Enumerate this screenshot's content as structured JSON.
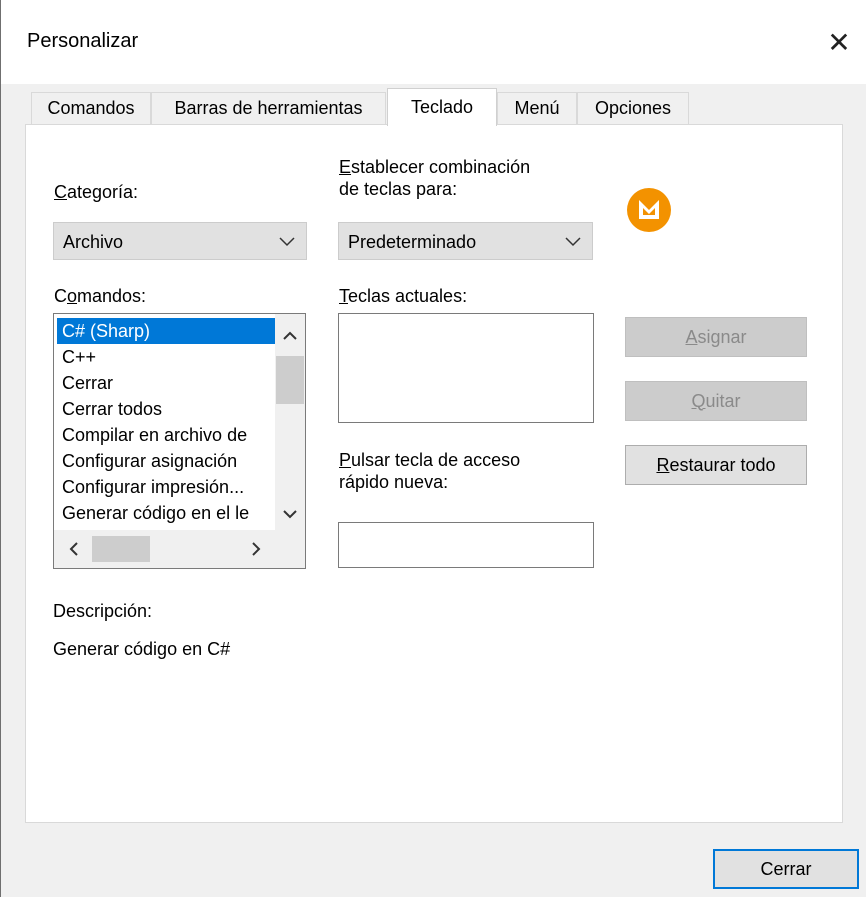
{
  "window": {
    "title": "Personalizar"
  },
  "tabs": [
    {
      "label": "Comandos"
    },
    {
      "label": "Barras de herramientas"
    },
    {
      "label": "Teclado"
    },
    {
      "label": "Menú"
    },
    {
      "label": "Opciones"
    }
  ],
  "category": {
    "label_first": "C",
    "label_rest": "ategoría:",
    "value": "Archivo"
  },
  "keyset": {
    "line1_first": "E",
    "line1_rest": "stablecer combinación",
    "line2": "de teclas para:",
    "value": "Predeterminado"
  },
  "commands": {
    "label_pre": "C",
    "label_u": "o",
    "label_rest": "mandos:",
    "items": [
      "C# (Sharp)",
      "C++",
      "Cerrar",
      "Cerrar todos",
      "Compilar en archivo de",
      "Configurar asignación",
      "Configurar impresión...",
      "Generar código en el le"
    ],
    "selected_index": 0
  },
  "current_keys": {
    "label_first": "T",
    "label_rest": "eclas actuales:"
  },
  "new_shortcut": {
    "line1_first": "P",
    "line1_rest": "ulsar tecla de acceso",
    "line2": "rápido nueva:"
  },
  "buttons": {
    "assign_first": "A",
    "assign_rest": "signar",
    "remove_first": "Q",
    "remove_rest": "uitar",
    "reset_first": "R",
    "reset_rest": "estaurar todo",
    "close": "Cerrar"
  },
  "description": {
    "label": "Descripción:",
    "text": "Generar código en C#"
  },
  "colors": {
    "accent": "#0078d7",
    "logo": "#f39200"
  },
  "icons": {
    "close": "close-icon",
    "chevron": "chevron-down-icon",
    "logo": "altova-mobiletogether-logo-icon"
  }
}
